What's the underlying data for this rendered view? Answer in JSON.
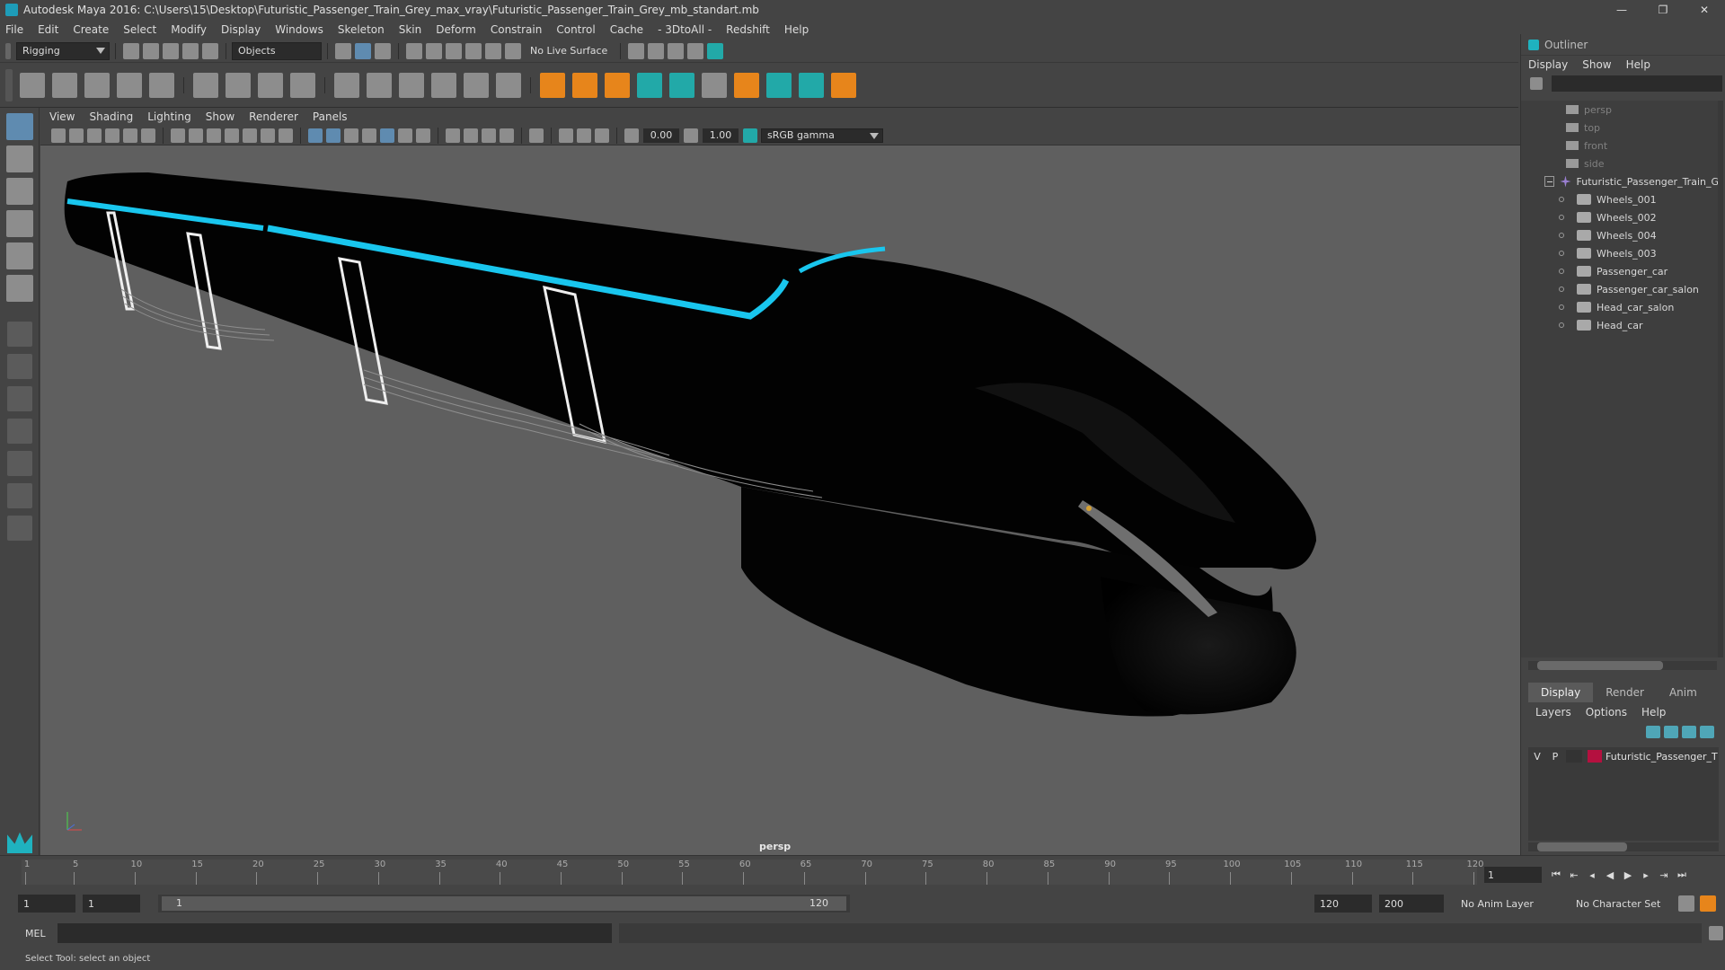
{
  "window": {
    "title": "Autodesk Maya 2016: C:\\Users\\15\\Desktop\\Futuristic_Passenger_Train_Grey_max_vray\\Futuristic_Passenger_Train_Grey_mb_standart.mb",
    "minimize": "—",
    "maximize": "❐",
    "close": "✕"
  },
  "menubar": [
    "File",
    "Edit",
    "Create",
    "Select",
    "Modify",
    "Display",
    "Windows",
    "Skeleton",
    "Skin",
    "Deform",
    "Constrain",
    "Control",
    "Cache",
    "- 3DtoAll -",
    "Redshift",
    "Help"
  ],
  "statusline": {
    "menuset": "Rigging",
    "selection_mode": "Objects",
    "live_surface": "No Live Surface"
  },
  "viewport": {
    "menu": [
      "View",
      "Shading",
      "Lighting",
      "Show",
      "Renderer",
      "Panels"
    ],
    "exposure": "0.00",
    "gamma": "1.00",
    "color_space": "sRGB gamma",
    "camera": "persp",
    "accent_color": "#19c6ee"
  },
  "outliner": {
    "title": "Outliner",
    "menu": [
      "Display",
      "Show",
      "Help"
    ],
    "cameras": [
      "persp",
      "top",
      "front",
      "side"
    ],
    "root": "Futuristic_Passenger_Train_G",
    "children": [
      "Wheels_001",
      "Wheels_002",
      "Wheels_004",
      "Wheels_003",
      "Passenger_car",
      "Passenger_car_salon",
      "Head_car_salon",
      "Head_car"
    ]
  },
  "layers": {
    "tabs": [
      "Display",
      "Render",
      "Anim"
    ],
    "menu": [
      "Layers",
      "Options",
      "Help"
    ],
    "layer_v": "V",
    "layer_p": "P",
    "layer_name": "Futuristic_Passenger_T",
    "layer_color": "#b4103f"
  },
  "timeline": {
    "ticks": [
      1,
      5,
      10,
      15,
      20,
      25,
      30,
      35,
      40,
      45,
      50,
      55,
      60,
      65,
      70,
      75,
      80,
      85,
      90,
      95,
      100,
      105,
      110,
      115,
      120
    ],
    "current_frame": "1"
  },
  "range": {
    "start": "1",
    "playback_start": "1",
    "slider_start": "1",
    "slider_end": "120",
    "playback_end": "120",
    "end": "200",
    "anim_layer": "No Anim Layer",
    "character_set": "No Character Set"
  },
  "commandline": {
    "language": "MEL"
  },
  "helpline": {
    "text": "Select Tool: select an object"
  }
}
